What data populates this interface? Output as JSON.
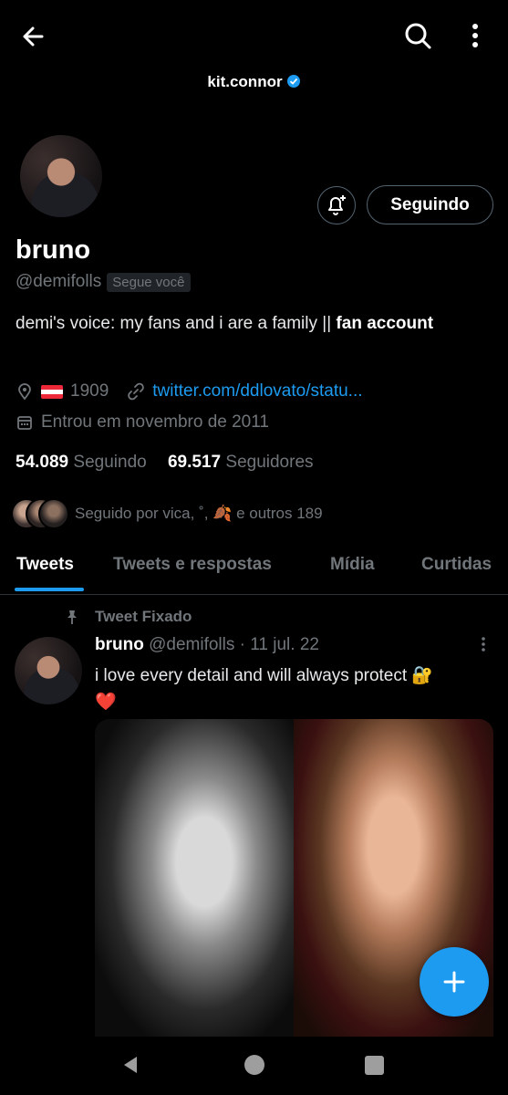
{
  "header": {
    "title": "kit.connor"
  },
  "profile": {
    "display_name": "bruno",
    "handle": "@demifolls",
    "follows_you": "Segue você",
    "follow_button": "Seguindo",
    "bio_prefix": "demi's voice: my fans and i are a family || ",
    "bio_bold": "fan account",
    "location": "1909",
    "link": "twitter.com/ddlovato/statu...",
    "joined": "Entrou em novembro de 2011",
    "following_count": "54.089",
    "following_label": "Seguindo",
    "followers_count": "69.517",
    "followers_label": "Seguidores",
    "followed_by": "Seguido por vica, ˚, 🍂 e outros 189"
  },
  "tabs": [
    {
      "label": "Tweets"
    },
    {
      "label": "Tweets e respostas"
    },
    {
      "label": "Mídia"
    },
    {
      "label": "Curtidas"
    }
  ],
  "tweet": {
    "pinned_label": "Tweet Fixado",
    "name": "bruno",
    "handle": "@demifolls",
    "date": "· 11 jul. 22",
    "text": "i love every detail and will always protect 🔐",
    "emoji_line": "❤️"
  },
  "colors": {
    "accent": "#1d9bf0",
    "background": "#000000",
    "secondary_text": "#71767b"
  }
}
